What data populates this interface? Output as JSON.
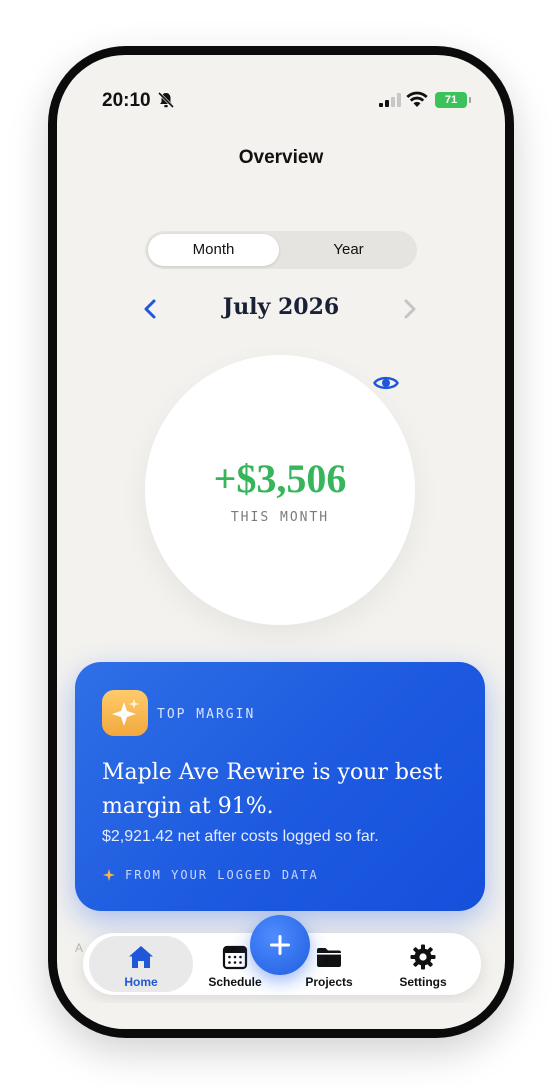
{
  "status_bar": {
    "time": "20:10",
    "battery": "71"
  },
  "header": {
    "title": "Overview"
  },
  "segmented": {
    "month_label": "Month",
    "year_label": "Year",
    "selected": "Month"
  },
  "month_nav": {
    "label": "July 2026"
  },
  "summary": {
    "amount": "+$3,506",
    "caption": "THIS MONTH"
  },
  "insight_card": {
    "kicker": "TOP MARGIN",
    "headline": "Maple Ave Rewire is your best margin at 91%.",
    "subtext": "$2,921.42 net after costs logged so far.",
    "footer": "FROM YOUR LOGGED DATA"
  },
  "peek_text": "A",
  "tab_bar": {
    "home": "Home",
    "schedule": "Schedule",
    "projects": "Projects",
    "settings": "Settings",
    "active": "Home"
  },
  "colors": {
    "accent": "#1f57d8",
    "positive": "#36b55a",
    "card": "#1d5ae0",
    "background": "#f3f2ef"
  }
}
